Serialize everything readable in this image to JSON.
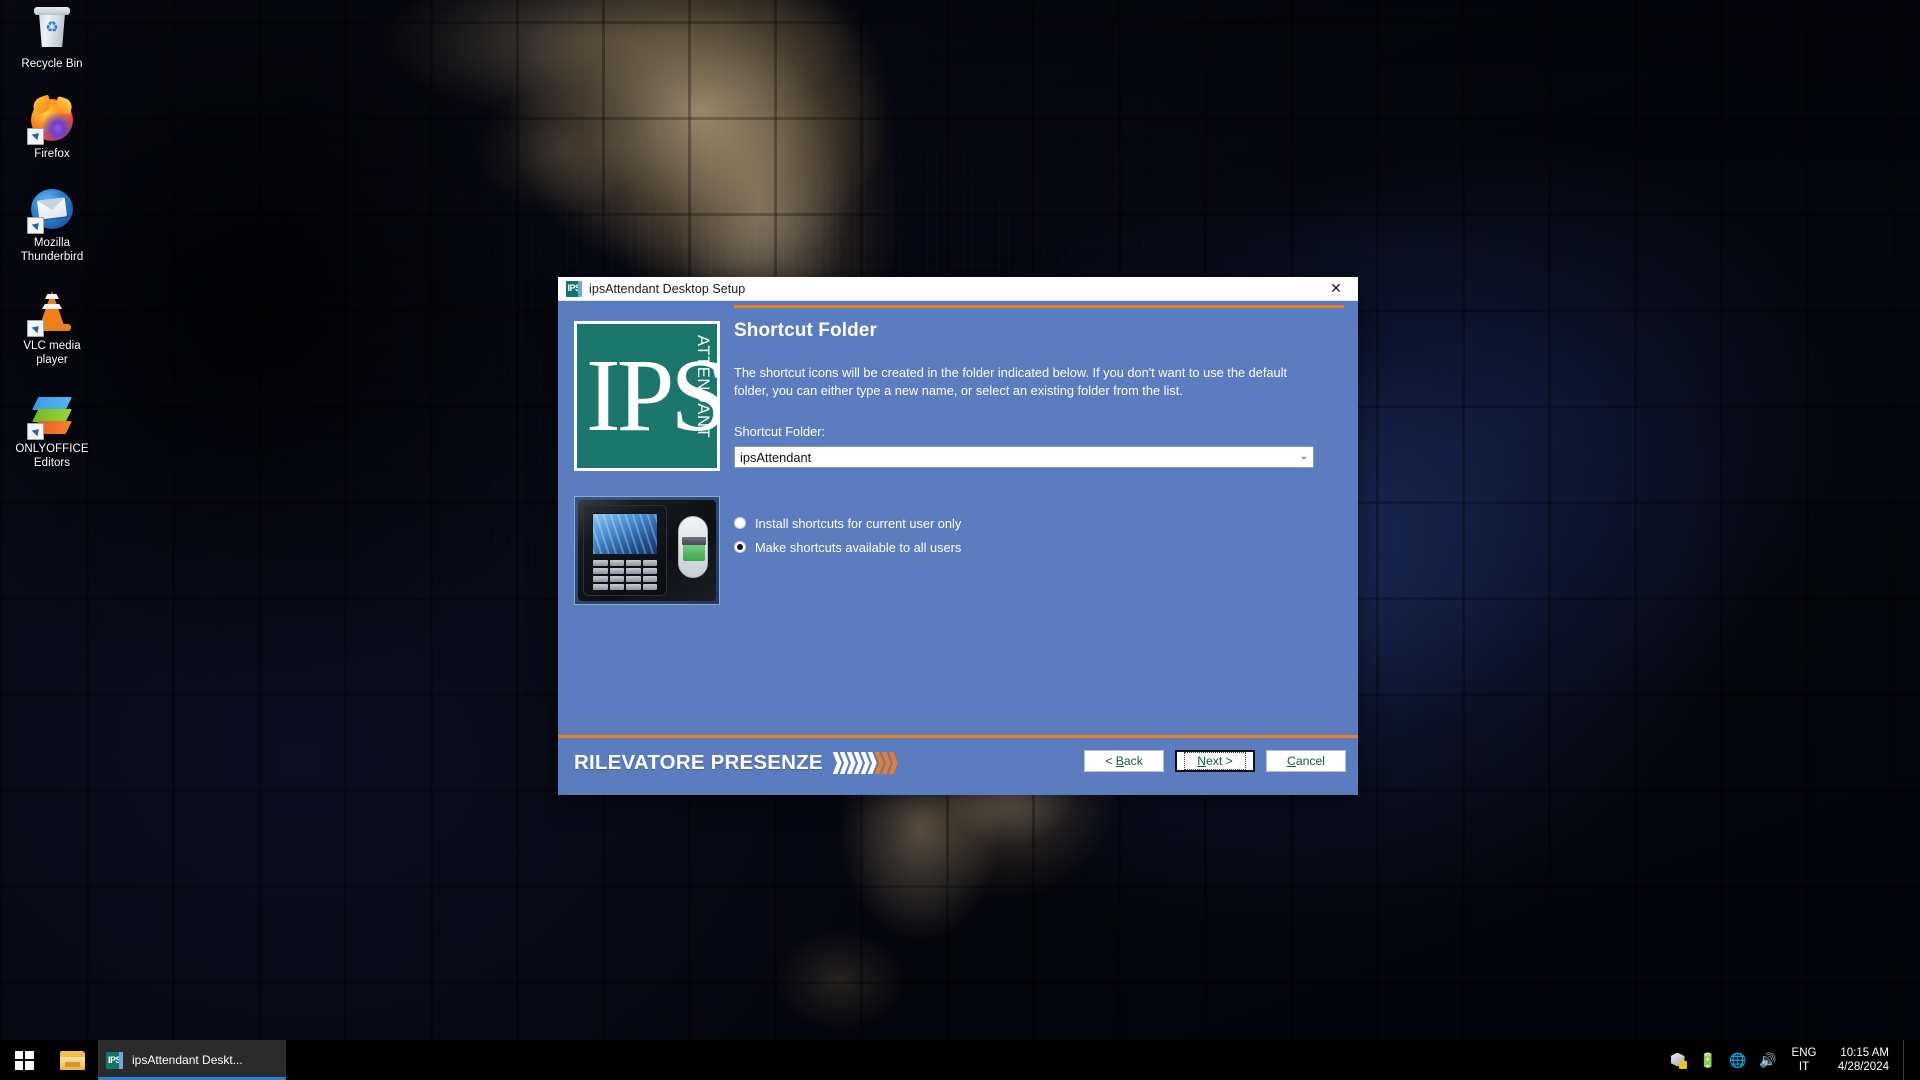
{
  "desktop": {
    "icons": [
      {
        "label": "Recycle Bin",
        "icon": "recycle-bin-icon",
        "shortcut": false
      },
      {
        "label": "Firefox",
        "icon": "firefox-icon",
        "shortcut": true
      },
      {
        "label": "Mozilla Thunderbird",
        "icon": "thunderbird-icon",
        "shortcut": true
      },
      {
        "label": "VLC media player",
        "icon": "vlc-icon",
        "shortcut": true
      },
      {
        "label": "ONLYOFFICE Editors",
        "icon": "onlyoffice-icon",
        "shortcut": true
      }
    ]
  },
  "setup_window": {
    "title": "ipsAttendant Desktop Setup",
    "title_icon": "ips-app-icon",
    "close_label": "✕",
    "logo": {
      "mark": "IPS",
      "wordmark": "ATTENDANT",
      "background_color": "#1b766b"
    },
    "device_image_alt": "ips attendance terminal with keypad and fingerprint reader",
    "page_title": "Shortcut Folder",
    "description": "The shortcut icons will be created in the folder indicated below. If you don't want to use the default folder, you can either type a new name, or select an existing folder from the list.",
    "field_label": "Shortcut Folder:",
    "combo": {
      "value": "ipsAttendant",
      "arrow": "⌄"
    },
    "options": [
      {
        "label": "Install shortcuts for current user only",
        "checked": false
      },
      {
        "label": "Make shortcuts available to all users",
        "checked": true
      }
    ],
    "footer": {
      "brand": "RILEVATORE PRESENZE",
      "chevrons_white": 6,
      "chevrons_orange": 3,
      "accent_color": "#f07d1d",
      "panel_color": "#5b7cbe"
    },
    "buttons": [
      {
        "label_pre": "< ",
        "label_accel": "B",
        "label_post": "ack",
        "name": "back-button",
        "focused": false
      },
      {
        "label_pre": "",
        "label_accel": "N",
        "label_post": "ext >",
        "name": "next-button",
        "focused": true
      },
      {
        "label_pre": "",
        "label_accel": "C",
        "label_post": "ancel",
        "name": "cancel-button",
        "focused": false
      }
    ]
  },
  "taskbar": {
    "start_tooltip": "Start",
    "explorer_tooltip": "File Explorer",
    "task_item": {
      "label": "ipsAttendant Deskt...",
      "active": true
    },
    "tray": {
      "icons": [
        "virtualbox-icon",
        "battery-icon",
        "network-icon",
        "volume-icon"
      ],
      "battery_glyph": "ὐC",
      "network_glyph": "⊕",
      "volume_glyph": "🔊",
      "language_line1": "ENG",
      "language_line2": "IT",
      "time": "10:15 AM",
      "date": "4/28/2024"
    }
  }
}
